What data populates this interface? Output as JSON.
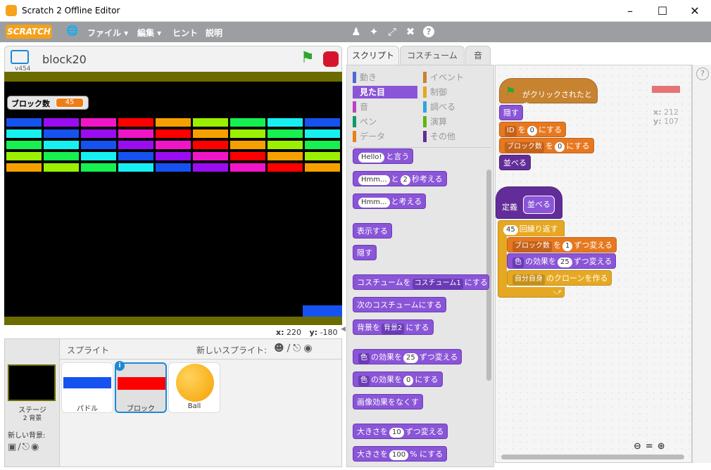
{
  "window": {
    "title": "Scratch 2 Offline Editor"
  },
  "menubar": {
    "logo": "SCRATCH",
    "items": [
      "ファイル ▾",
      "編集 ▾",
      "ヒント",
      "説明"
    ],
    "tool_icons": [
      "stamp-icon",
      "shrink-icon",
      "grow-icon",
      "expand-icon",
      "help-icon"
    ]
  },
  "stage": {
    "version": "v454",
    "sprite_name": "block20",
    "score_label": "ブロック数",
    "score_value": "45",
    "x_label": "x:",
    "x_value": "220",
    "y_label": "y:",
    "y_value": "-180",
    "brick_rows": [
      [
        "#1652f0",
        "#9a0df0",
        "#f016c8",
        "#ff0000",
        "#f6a000",
        "#9af000",
        "#16f050",
        "#16f0f0",
        "#1652f0"
      ],
      [
        "#16f0f0",
        "#1652f0",
        "#9a0df0",
        "#f016c8",
        "#ff0000",
        "#f6a000",
        "#9af000",
        "#16f050",
        "#16f0f0"
      ],
      [
        "#16f050",
        "#16f0f0",
        "#1652f0",
        "#9a0df0",
        "#f016c8",
        "#ff0000",
        "#f6a000",
        "#9af000",
        "#16f050"
      ],
      [
        "#9af000",
        "#16f050",
        "#16f0f0",
        "#1652f0",
        "#9a0df0",
        "#f016c8",
        "#ff0000",
        "#f6a000",
        "#9af000"
      ],
      [
        "#f6a000",
        "#9af000",
        "#16f050",
        "#16f0f0",
        "#1652f0",
        "#9a0df0",
        "#f016c8",
        "#ff0000",
        "#f6a000"
      ]
    ]
  },
  "sprites": {
    "header": "スプライト",
    "new_sprite": "新しいスプライト:",
    "stage_label": "ステージ",
    "stage_sub": "2 背景",
    "new_backdrop": "新しい背景:",
    "items": [
      {
        "name": "パドル",
        "color": "#1652f0"
      },
      {
        "name": "ブロック",
        "color": "#ff0000"
      },
      {
        "name": "Ball",
        "color": "#f6a000"
      }
    ]
  },
  "tabs": [
    "スクリプト",
    "コスチューム",
    "音"
  ],
  "categories": [
    {
      "label": "動き",
      "color": "#4a6cd4"
    },
    {
      "label": "イベント",
      "color": "#c88330"
    },
    {
      "label": "見た目",
      "color": "#8a55d7"
    },
    {
      "label": "制御",
      "color": "#e1a91a"
    },
    {
      "label": "音",
      "color": "#bb42c3"
    },
    {
      "label": "調べる",
      "color": "#2ca5e2"
    },
    {
      "label": "ペン",
      "color": "#0e9a6c"
    },
    {
      "label": "演算",
      "color": "#5cb712"
    },
    {
      "label": "データ",
      "color": "#ee7d16"
    },
    {
      "label": "その他",
      "color": "#632d99"
    }
  ],
  "palette_blocks": {
    "say_field": "Hello!",
    "say_text": "と言う",
    "think_secs_field": "Hmm...",
    "think_secs_mid": "と",
    "think_secs_num": "2",
    "think_secs_text": "秒考える",
    "think_field": "Hmm...",
    "think_text": "と考える",
    "show": "表示する",
    "hide": "隠す",
    "costume_prefix": "コスチュームを",
    "costume_drop": "コスチューム1",
    "costume_suffix": "にする",
    "next_costume": "次のコスチュームにする",
    "backdrop_prefix": "背景を",
    "backdrop_drop": "背景2",
    "backdrop_suffix": "にする",
    "effect_drop": "色",
    "effect_change_mid": "の効果を",
    "effect_change_num": "25",
    "effect_change_text": "ずつ変える",
    "effect_set_mid": "の効果を",
    "effect_set_num": "0",
    "effect_set_text": "にする",
    "clear_effects": "画像効果をなくす",
    "size_change_prefix": "大きさを",
    "size_change_num": "10",
    "size_change_text": "ずつ変える",
    "size_set_prefix": "大きさを",
    "size_set_num": "100",
    "size_set_text": "% にする"
  },
  "scripts": {
    "hat": "がクリックされたとき",
    "hide": "隠す",
    "set1_var": "ID",
    "set1_mid": "を",
    "set1_val": "0",
    "set1_suffix": "にする",
    "set2_var": "ブロック数",
    "set2_mid": "を",
    "set2_val": "0",
    "set2_suffix": "にする",
    "call": "並べる",
    "define": "定義",
    "define_name": "並べる",
    "repeat_num": "45",
    "repeat_text": "回繰り返す",
    "change_var": "ブロック数",
    "change_mid": "を",
    "change_val": "1",
    "change_suffix": "ずつ変える",
    "effect_drop": "色",
    "effect_mid": "の効果を",
    "effect_val": "25",
    "effect_suffix": "ずつ変える",
    "clone_drop": "自分自身",
    "clone_text": "のクローンを作る",
    "x_label": "x:",
    "x_value": "212",
    "y_label": "y:",
    "y_value": "107"
  }
}
